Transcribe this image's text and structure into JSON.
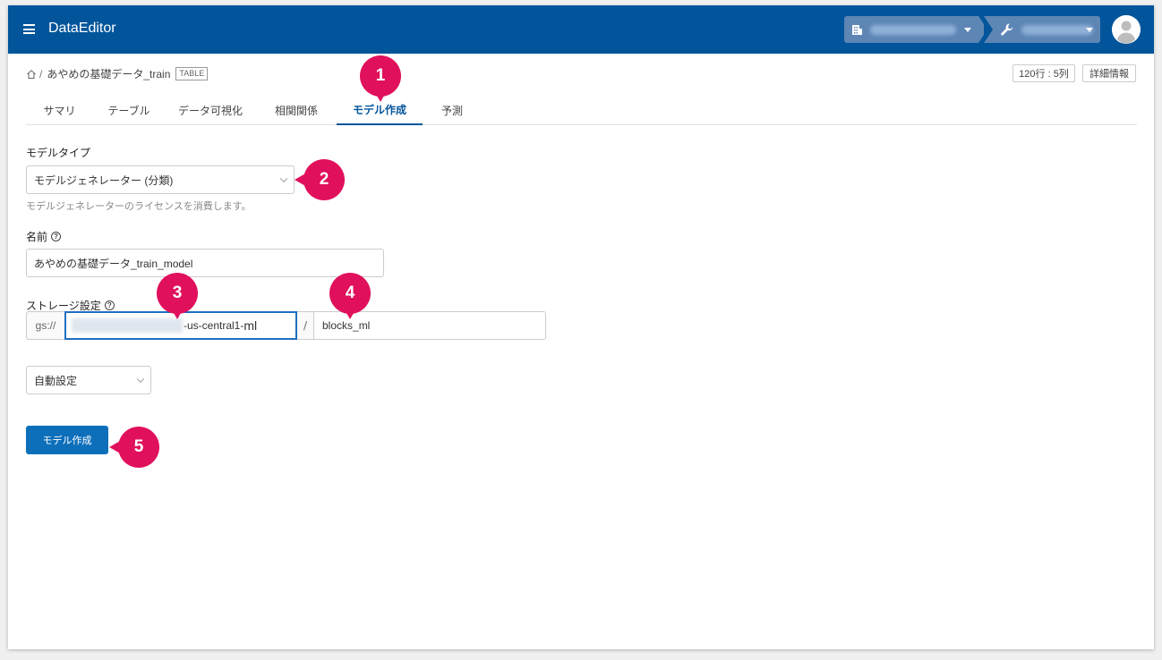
{
  "app": {
    "title": "DataEditor"
  },
  "breadcrumb": {
    "dataset": "あやめの基礎データ_train",
    "separator": "/",
    "type_badge": "TABLE"
  },
  "header_chips": {
    "size": "120行 : 5列",
    "details": "詳細情報"
  },
  "tabs": [
    {
      "label": "サマリ",
      "active": false
    },
    {
      "label": "テーブル",
      "active": false
    },
    {
      "label": "データ可視化",
      "active": false
    },
    {
      "label": "相関関係",
      "active": false
    },
    {
      "label": "モデル作成",
      "active": true
    },
    {
      "label": "予測",
      "active": false
    }
  ],
  "form": {
    "model_type": {
      "label": "モデルタイプ",
      "value": "モデルジェネレーター (分類)",
      "hint": "モデルジェネレーターのライセンスを消費します。"
    },
    "name": {
      "label": "名前",
      "value": "あやめの基礎データ_train_model"
    },
    "storage": {
      "label": "ストレージ設定",
      "prefix": "gs://",
      "bucket_suffix": "-us-central1-",
      "bucket_ml": "ml",
      "separator": "/",
      "path": "blocks_ml"
    },
    "region": {
      "value": "自動設定"
    },
    "submit_label": "モデル作成"
  },
  "callouts": [
    "1",
    "2",
    "3",
    "4",
    "5"
  ],
  "colors": {
    "appbar": "#02559b",
    "accent": "#0d6fba",
    "callout": "#e0105c"
  },
  "icons": {
    "menu": "menu-icon",
    "building": "building-icon",
    "wrench": "wrench-icon",
    "home": "home-icon",
    "help": "help-icon",
    "avatar": "avatar-icon"
  }
}
